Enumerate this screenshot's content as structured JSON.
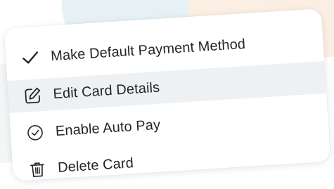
{
  "menu": {
    "items": [
      {
        "label": "Make Default Payment Method",
        "icon": "checkmark-icon",
        "highlighted": false
      },
      {
        "label": "Edit Card Details",
        "icon": "edit-pencil-icon",
        "highlighted": true
      },
      {
        "label": "Enable Auto Pay",
        "icon": "check-circle-icon",
        "highlighted": false
      },
      {
        "label": "Delete Card",
        "icon": "trash-icon",
        "highlighted": false
      }
    ]
  },
  "colors": {
    "text": "#25262b",
    "hover_background": "#eef1f3",
    "card_background": "#ffffff"
  }
}
